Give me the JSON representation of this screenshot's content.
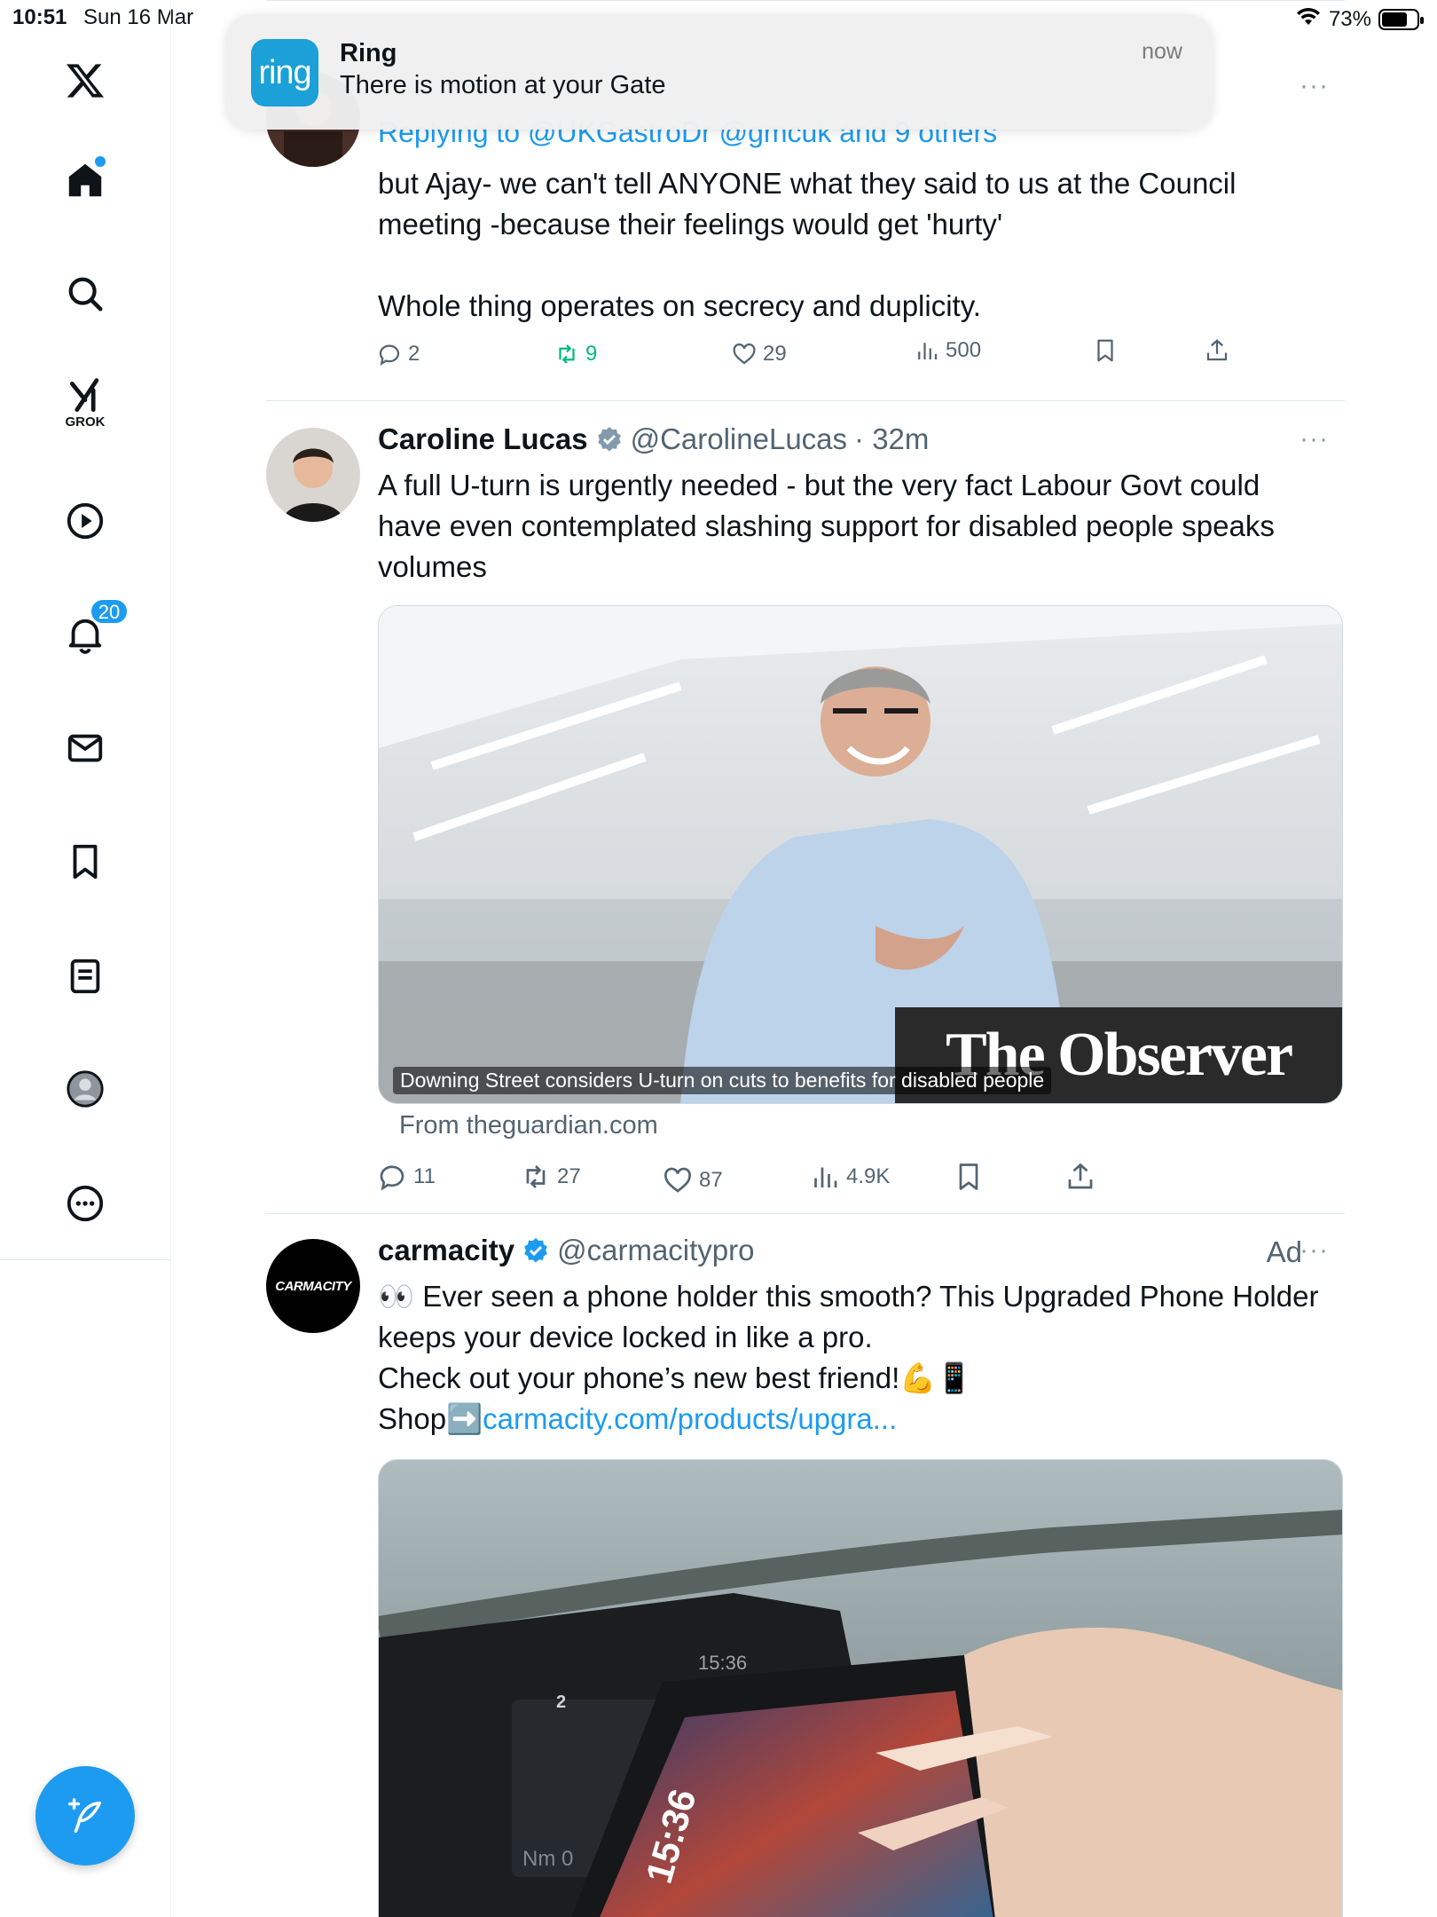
{
  "status_bar": {
    "time": "10:51",
    "date": "Sun 16 Mar",
    "battery": "73%",
    "battery_level": 0.73
  },
  "notification": {
    "app_icon_text": "ring",
    "title": "Ring",
    "body": "There is motion at your Gate",
    "time": "now"
  },
  "sidebar": {
    "notifications_badge": "20",
    "grok_label": "GROK",
    "items": [
      "x-logo",
      "home",
      "search",
      "grok",
      "video",
      "notifications",
      "messages",
      "bookmarks",
      "lists",
      "profile",
      "more"
    ]
  },
  "tweets": [
    {
      "replying_to": "Replying to @UKGastroDr @gmcuk and 9 others",
      "text_line1": "but Ajay- we can't tell ANYONE what they said to us at the Council",
      "text_line2": "meeting -because their feelings would get 'hurty'",
      "text_line3": "Whole thing operates on secrecy and duplicity.",
      "replies": "2",
      "retweets": "9",
      "likes": "29",
      "views": "500",
      "more": "···"
    },
    {
      "name": "Caroline Lucas",
      "handle": "@CarolineLucas",
      "time": "· 32m",
      "text_line1": "A full U-turn is urgently needed - but the very fact Labour Govt could",
      "text_line2": "have even contemplated slashing support for disabled people speaks",
      "text_line3": "volumes",
      "media_caption": "Downing Street considers U-turn on cuts to benefits for disabled people",
      "media_logo": "The Observer",
      "source": "From theguardian.com",
      "replies": "11",
      "retweets": "27",
      "likes": "87",
      "views": "4.9K",
      "more": "···"
    },
    {
      "name": "carmacity",
      "handle": "@carmacitypro",
      "ad_label": "Ad",
      "avatar_text": "CARMACITY",
      "text_line1": "👀 Ever seen a phone holder this smooth? This Upgraded Phone Holder",
      "text_line2": "keeps your device locked in like a pro.",
      "text_line3": "Check out your phone’s new best friend!💪📱",
      "shop_prefix": "Shop➡️",
      "shop_link": "carmacity.com/products/upgra...",
      "media_clock": "15:36",
      "media_small_clock": "15:36",
      "media_gear": "2",
      "media_nm": "Nm 0",
      "more": "···"
    }
  ],
  "colors": {
    "accent": "#1d9bf0",
    "retweet_green": "#00ba7c",
    "muted": "#536471",
    "ring_blue": "#1ba0d7"
  }
}
